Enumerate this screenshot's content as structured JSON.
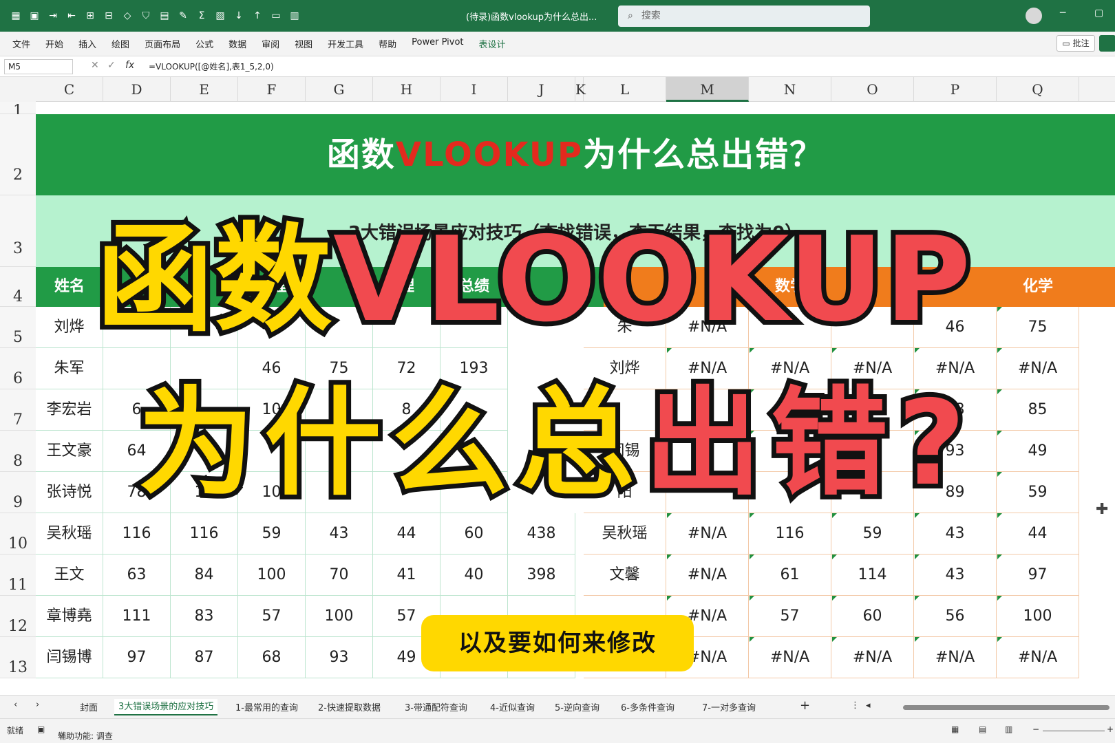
{
  "window": {
    "title": "(待录)函数vlookup为什么总出...",
    "search_placeholder": "搜索",
    "quick_access_icons": [
      "excel-icon",
      "save-icon",
      "insert-row-icon",
      "delete-row-icon",
      "merge-icon",
      "freeze-icon",
      "shape-icon",
      "filter-icon",
      "table-icon",
      "paint-icon",
      "sum-icon",
      "paste-icon",
      "sort-asc-icon",
      "sort-desc-icon",
      "textbox-icon",
      "format-icon"
    ]
  },
  "ribbon": {
    "tabs": [
      "文件",
      "开始",
      "插入",
      "绘图",
      "页面布局",
      "公式",
      "数据",
      "审阅",
      "视图",
      "开发工具",
      "帮助",
      "Power Pivot",
      "表设计"
    ],
    "selected_tab": "表设计",
    "comment_label": "批注"
  },
  "formula_bar": {
    "name_box": "M5",
    "fx_label": "fx",
    "formula": "=VLOOKUP([@姓名],表1_5,2,0)"
  },
  "columns": [
    "C",
    "D",
    "E",
    "F",
    "G",
    "H",
    "I",
    "J",
    "K",
    "L",
    "M",
    "N",
    "O",
    "P",
    "Q"
  ],
  "selected_column": "M",
  "rows": [
    "1",
    "2",
    "3",
    "4",
    "5",
    "6",
    "7",
    "8",
    "9",
    "10",
    "11",
    "12",
    "13"
  ],
  "sheet": {
    "title_part1": "函数",
    "title_red": "VLOOKUP",
    "title_part2": "为什么总出错？",
    "subtitle": "3大错误场景应对技巧（查找错误，查无结果，查找为0）",
    "left_headers": [
      "姓名",
      "",
      "",
      "物理",
      "",
      "理",
      "总绩"
    ],
    "right_headers": [
      "",
      "",
      "数学",
      "",
      "",
      "化学"
    ],
    "left_rows": [
      [
        "刘烨",
        "",
        "7",
        "6",
        "",
        "",
        ""
      ],
      [
        "朱军",
        "",
        "",
        "46",
        "75",
        "72",
        "193"
      ],
      [
        "李宏岩",
        "6",
        "",
        "10",
        "4",
        "8",
        ""
      ],
      [
        "王文豪",
        "64",
        "",
        "",
        "",
        "",
        ""
      ],
      [
        "张诗悦",
        "78",
        "11",
        "10",
        "",
        "",
        ""
      ],
      [
        "吴秋瑶",
        "116",
        "116",
        "59",
        "43",
        "44",
        "60",
        "438"
      ],
      [
        "王文",
        "63",
        "84",
        "100",
        "70",
        "41",
        "40",
        "398"
      ],
      [
        "章博堯",
        "111",
        "83",
        "57",
        "100",
        "57",
        "",
        ""
      ],
      [
        "闫锡博",
        "97",
        "87",
        "68",
        "93",
        "49",
        "",
        ""
      ]
    ],
    "right_rows": [
      [
        "朱",
        "#N/A",
        "",
        "",
        "46",
        "75"
      ],
      [
        "刘烨",
        "#N/A",
        "#N/A",
        "#N/A",
        "#N/A",
        "#N/A"
      ],
      [
        "",
        "",
        "",
        "",
        "48",
        "85"
      ],
      [
        "闫锡",
        "",
        "",
        "8",
        "93",
        "49"
      ],
      [
        "阳",
        "",
        "",
        "20",
        "89",
        "59"
      ],
      [
        "吴秋瑶",
        "#N/A",
        "116",
        "59",
        "43",
        "44"
      ],
      [
        "文馨",
        "#N/A",
        "61",
        "114",
        "43",
        "97"
      ],
      [
        "",
        "#N/A",
        "57",
        "60",
        "56",
        "100"
      ],
      [
        "",
        "#N/A",
        "#N/A",
        "#N/A",
        "#N/A",
        "#N/A"
      ]
    ]
  },
  "overlay": {
    "line1_yellow": "函数",
    "line1_red": "VLOOKUP",
    "line2_yellow": "为什么总",
    "line2_red": "出错?",
    "pill": "以及要如何来修改"
  },
  "sheet_tabs": [
    "封面",
    "3大错误场景的应对技巧",
    "1-最常用的查询",
    "2-快速提取数据",
    "3-带通配符查询",
    "4-近似查询",
    "5-逆向查询",
    "6-多条件查询",
    "7-一对多查询"
  ],
  "active_sheet_tab": "3大错误场景的应对技巧",
  "status": {
    "ready": "就绪",
    "accessibility": "辅助功能: 调查"
  },
  "colors": {
    "excel_green": "#1f7244",
    "banner_green": "#219b46",
    "light_green": "#b6f2cf",
    "orange": "#f07c1c",
    "overlay_yellow": "#ffd800",
    "overlay_red": "#f14a4f",
    "title_red": "#e32a1e"
  }
}
